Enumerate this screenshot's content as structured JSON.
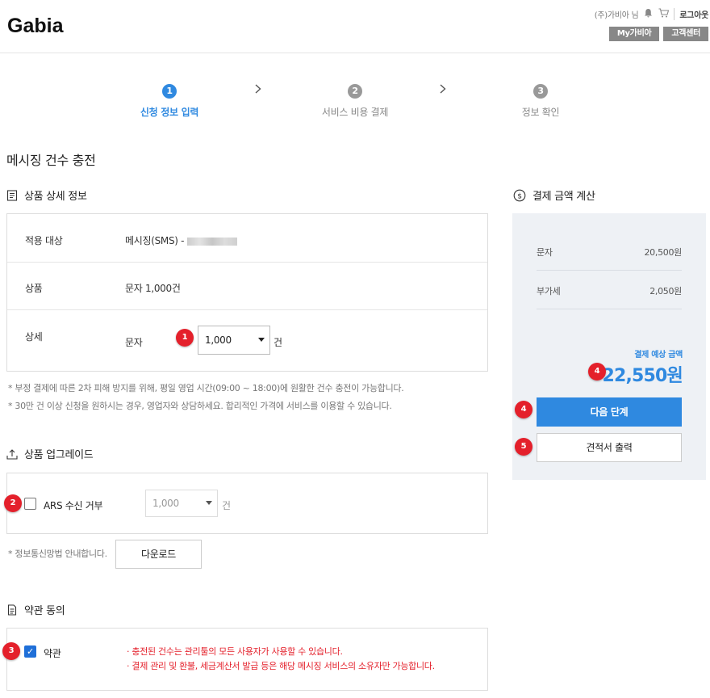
{
  "header": {
    "logo": "Gabia",
    "user_label": "(주)가비아 님",
    "logout": "로그아웃",
    "mygabia": "My가비아",
    "support": "고객센터"
  },
  "steps": [
    {
      "num": "1",
      "label": "신청 정보 입력",
      "active": true
    },
    {
      "num": "2",
      "label": "서비스 비용 결제",
      "active": false
    },
    {
      "num": "3",
      "label": "정보 확인",
      "active": false
    }
  ],
  "page_title": "메시징 건수 충전",
  "product_detail": {
    "title": "상품 상세 정보",
    "rows": [
      {
        "key": "적용 대상",
        "value": "메시징(SMS) -"
      },
      {
        "key": "상품",
        "value": "문자 1,000건"
      },
      {
        "key": "상세",
        "value": "문자"
      }
    ],
    "quantity_selected": "1,000",
    "unit": "건"
  },
  "notes": [
    "*  부정 결제에 따른 2차 피해 방지를 위해, 평일 영업 시간(09:00 ~ 18:00)에 원활한 건수 충전이 가능합니다.",
    "*  30만 건 이상 신청을 원하시는 경우, 영업자와 상담하세요. 합리적인 가격에 서비스를 이용할 수 있습니다."
  ],
  "upgrade": {
    "title": "상품 업그레이드",
    "option_label": "ARS 수신 거부",
    "select_value": "1,000",
    "unit": "건",
    "info_note": "*  정보통신망법 안내합니다.",
    "download": "다운로드"
  },
  "terms": {
    "title": "약관 동의",
    "label": "약관",
    "lines": [
      "·  충전된 건수는 관리툴의 모든 사용자가 사용할 수 있습니다.",
      "·  결제 관리 및 환불, 세금계산서 발급 등은 해당 메시징 서비스의 소유자만 가능합니다."
    ]
  },
  "calc": {
    "title": "결제 금액 계산",
    "items": [
      {
        "label": "문자",
        "amount": "20,500원"
      },
      {
        "label": "부가세",
        "amount": "2,050원"
      }
    ],
    "estimate_label": "결제 예상 금액",
    "estimate_amount": "22,550원",
    "next": "다음 단계",
    "quote": "견적서 출력"
  },
  "badges": [
    "1",
    "2",
    "3",
    "4",
    "4",
    "5"
  ],
  "colors": {
    "accent": "#2f89e0",
    "badge": "#e4202b",
    "panel": "#eef1f5"
  }
}
